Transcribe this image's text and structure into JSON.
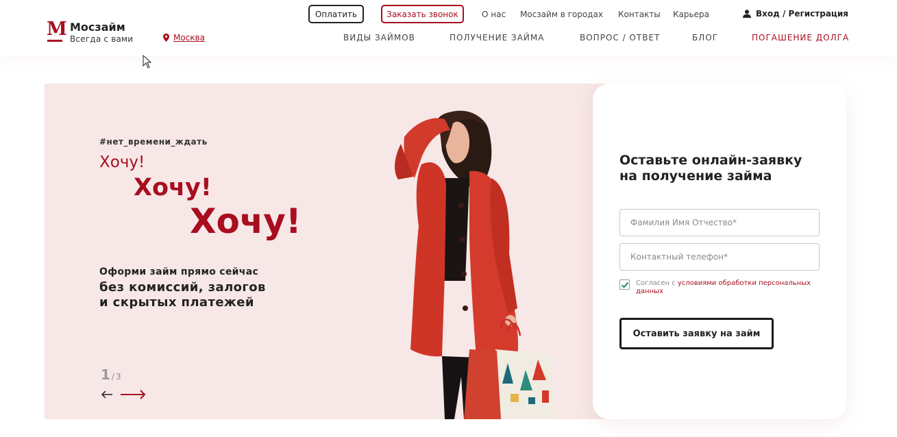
{
  "header": {
    "logo_letter": "М",
    "brand": "Мосзайм",
    "tagline": "Всегда с вами",
    "city": "Москва",
    "pay_button": "Оплатить",
    "call_button": "Заказать звонок",
    "top_links": [
      "О нас",
      "Мосзайм в городах",
      "Контакты",
      "Карьера"
    ],
    "login": "Вход / Регистрация",
    "main_nav": [
      "ВИДЫ ЗАЙМОВ",
      "ПОЛУЧЕНИЕ ЗАЙМА",
      "ВОПРОС / ОТВЕТ",
      "БЛОГ",
      "ПОГАШЕНИЕ ДОЛГА"
    ]
  },
  "hero": {
    "hashtag": "#нет_времени_ждать",
    "want_small": "Хочу!",
    "want_medium": "Хочу!",
    "want_large": "Хочу!",
    "line1": "Оформи займ прямо сейчас",
    "line2": "без комиссий, залогов",
    "line3": "и скрытых платежей",
    "slide_current": "1",
    "slide_separator": "/",
    "slide_total": "3"
  },
  "form": {
    "title_line1": "Оставьте онлайн-заявку",
    "title_line2": "на получение займа",
    "name_placeholder": "Фамилия Имя Отчество*",
    "phone_placeholder": "Контактный телефон*",
    "agree_prefix": "Согласен с ",
    "agree_link": "условиями обработки персональных данных",
    "agree_checked": true,
    "submit": "Оставить заявку на займ"
  },
  "colors": {
    "accent": "#a80e1f",
    "hero_bg": "#f7e7e6",
    "checkbox": "#1a8a6a"
  }
}
